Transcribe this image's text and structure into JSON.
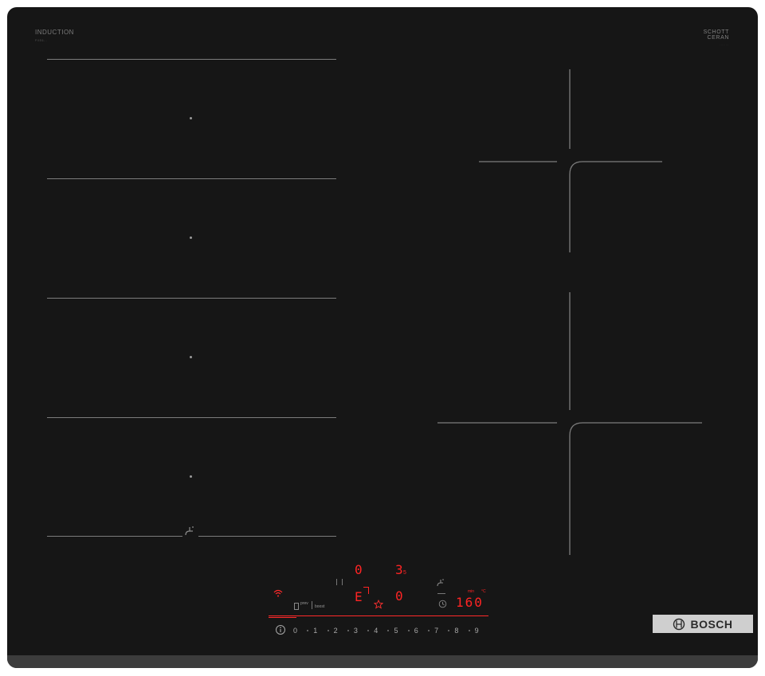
{
  "hob": {
    "label_induction": "INDUCTION",
    "label_model": "PXE6...",
    "schott_line1": "SCHOTT",
    "schott_line2": "CERAN",
    "schott_line3": "........"
  },
  "display": {
    "zone_left_top": "0",
    "zone_right_top": "3",
    "zone_right_top_sub": "5",
    "zone_left_bottom": "E",
    "zone_right_bottom": "0",
    "temperature": "160",
    "label_boost": "boost",
    "label_prev": "prev",
    "label_c": "°C",
    "label_min": "min"
  },
  "power_scale": [
    "0",
    "1",
    "2",
    "3",
    "4",
    "5",
    "6",
    "7",
    "8",
    "9"
  ],
  "brand": {
    "name": "BOSCH"
  },
  "colors": {
    "glass": "#161616",
    "display_red": "#ff2424",
    "badge": "#cfcfcf"
  }
}
